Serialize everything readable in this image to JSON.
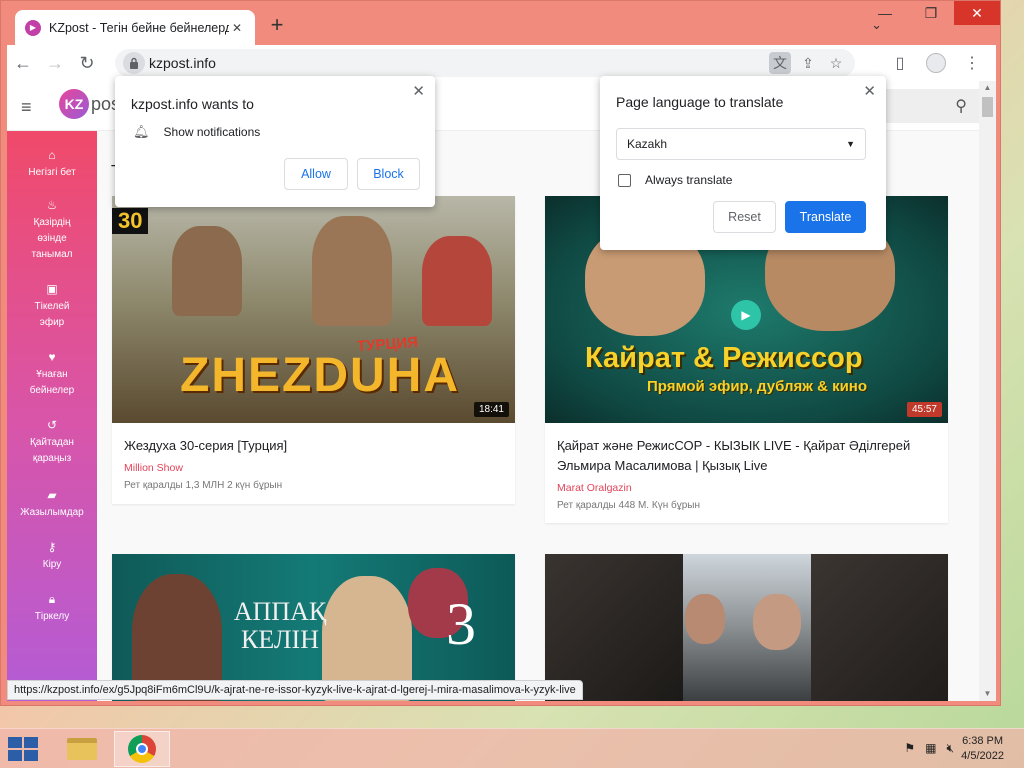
{
  "browser": {
    "tab_title": "KZpost - Тегін бейне бейнелерд",
    "url": "kzpost.info",
    "new_tab_symbol": "+",
    "close_tab_symbol": "✕"
  },
  "site": {
    "logo_badge": "KZ",
    "logo_text": "post"
  },
  "sidebar": {
    "items": [
      {
        "icon": "home-icon",
        "label": "Негізгі бет"
      },
      {
        "icon": "flame-icon",
        "label": "Қазірдің өзінде танымал"
      },
      {
        "icon": "live-icon",
        "label": "Тікелей эфир"
      },
      {
        "icon": "heart-icon",
        "label": "Ұнаған бейнелер"
      },
      {
        "icon": "history-icon",
        "label": "Қайтадан қараңыз"
      },
      {
        "icon": "folder-icon",
        "label": "Жазылымдар"
      },
      {
        "icon": "key-icon",
        "label": "Кіру"
      },
      {
        "icon": "lock-icon",
        "label": "Тіркелу"
      }
    ]
  },
  "section_title": "Т",
  "videos": [
    {
      "title": "Жездуха 30-серия [Турция]",
      "channel": "Million Show",
      "meta": "Рет қаралды 1,3 МЛН   2 күн бұрын",
      "duration": "18:41",
      "thumb_text": "ZHEZDUHA",
      "thumb_badge": "30",
      "thumb_sub": "ТУРЦИЯ"
    },
    {
      "title": "Қайрат және РежисСОР - КЫЗЫК LIVE - Қайрат Әділгерей Эльмира Масалимова | Қызық Live",
      "channel": "Marat Oralgazin",
      "meta": "Рет қаралды 448 М.   Күн бұрын",
      "duration": "45:57",
      "thumb_text": "Кайрат & Режиссор",
      "thumb_sub": "Прямой эфир, дубляж & кино"
    },
    {
      "thumb_text": "АППАҚ КЕЛІН",
      "thumb_badge": "3"
    },
    {
      "thumb_text": ""
    }
  ],
  "status_url": "https://kzpost.info/ex/g5Jpq8iFm6mCl9U/k-ajrat-ne-re-issor-kyzyk-live-k-ajrat-d-lgerej-l-mira-masalimova-k-yzyk-live",
  "notification_popup": {
    "title": "kzpost.info wants to",
    "permission": "Show notifications",
    "allow": "Allow",
    "block": "Block"
  },
  "translate_popup": {
    "title": "Page language to translate",
    "language": "Kazakh",
    "always_translate": "Always translate",
    "reset": "Reset",
    "translate": "Translate"
  },
  "taskbar": {
    "time": "6:38 PM",
    "date": "4/5/2022"
  }
}
